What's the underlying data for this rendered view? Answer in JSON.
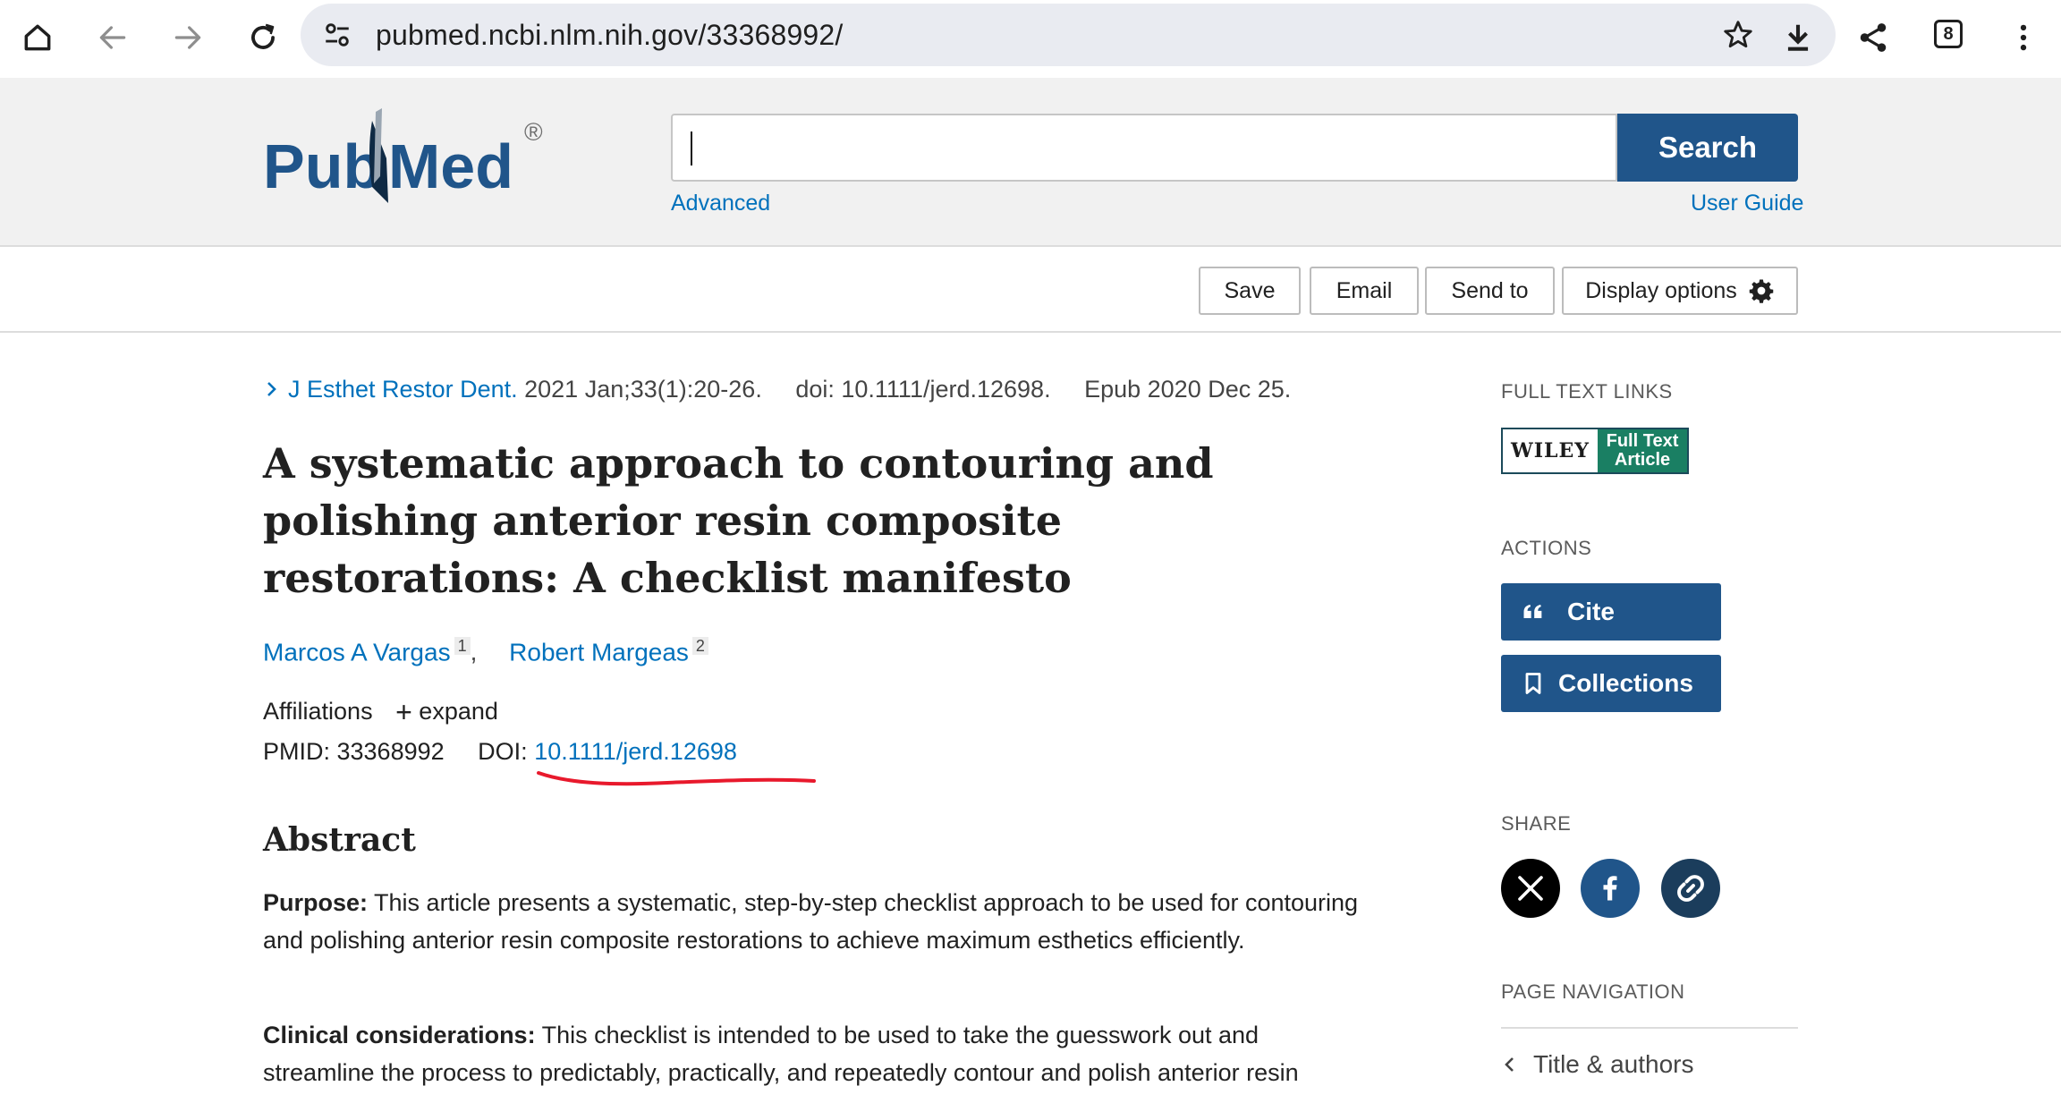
{
  "browser": {
    "url": "pubmed.ncbi.nlm.nih.gov/33368992/",
    "tab_count": "8"
  },
  "header": {
    "logo_text_left": "Pub",
    "logo_text_right": "Med",
    "logo_registered": "®",
    "search_placeholder": "",
    "search_button": "Search",
    "advanced_link": "Advanced",
    "user_guide_link": "User Guide"
  },
  "toolbar": {
    "save": "Save",
    "email": "Email",
    "send_to": "Send to",
    "display_options": "Display options"
  },
  "article": {
    "journal": "J Esthet Restor Dent.",
    "citation": "2021 Jan;33(1):20-26.",
    "doi_line": "doi: 10.1111/jerd.12698.",
    "epub": "Epub 2020 Dec 25.",
    "title": "A systematic approach to contouring and polishing anterior resin composite restorations: A checklist manifesto",
    "authors": [
      {
        "name": "Marcos A Vargas",
        "affil": "1"
      },
      {
        "name": "Robert Margeas",
        "affil": "2"
      }
    ],
    "affiliations_label": "Affiliations",
    "expand_label": "expand",
    "pmid_label": "PMID: 33368992",
    "doi_label": "DOI:",
    "doi_value": "10.1111/jerd.12698",
    "abstract_heading": "Abstract",
    "purpose_label": "Purpose:",
    "purpose_text": " This article presents a systematic, step-by-step checklist approach to be used for contouring and polishing anterior resin composite restorations to achieve maximum esthetics efficiently.",
    "clinical_label": "Clinical considerations:",
    "clinical_text": " This checklist is intended to be used to take the guesswork out and streamline the process to predictably, practically, and repeatedly contour and polish anterior resin"
  },
  "sidebar": {
    "full_text_heading": "FULL TEXT LINKS",
    "wiley_brand": "WILEY",
    "wiley_line1": "Full Text",
    "wiley_line2": "Article",
    "actions_heading": "ACTIONS",
    "cite_button": "Cite",
    "collections_button": "Collections",
    "share_heading": "SHARE",
    "page_nav_heading": "PAGE NAVIGATION",
    "page_nav_item": "Title & authors"
  },
  "colors": {
    "brand_blue": "#20558a",
    "link_blue": "#0071bc",
    "wiley_green": "#1a7f63",
    "annotation_red": "#e8192c"
  }
}
